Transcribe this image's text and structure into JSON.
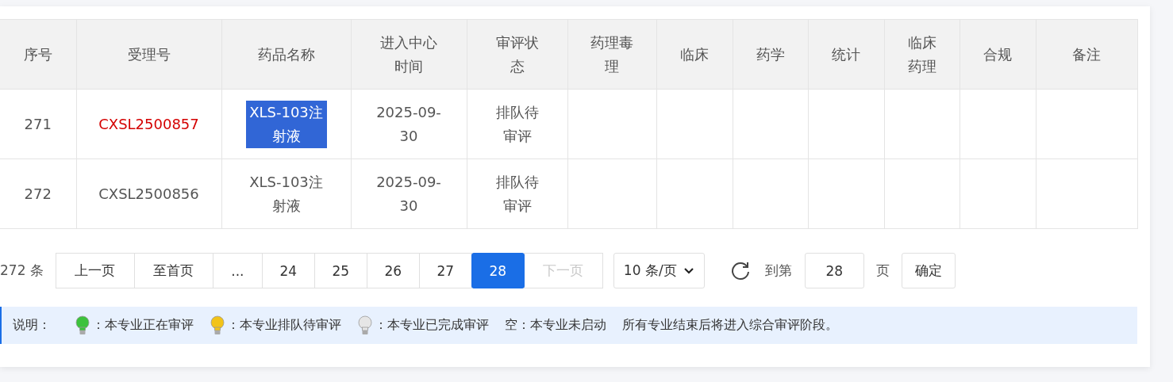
{
  "table": {
    "columns": [
      "序号",
      "受理号",
      "药品名称",
      "进入中心时间",
      "审评状态",
      "药理毒理",
      "临床",
      "药学",
      "统计",
      "临床药理",
      "合规",
      "备注"
    ],
    "rows": [
      {
        "index": "271",
        "accept_no": "CXSL2500857",
        "accept_no_flagged": true,
        "drug_name": "XLS-103注射液",
        "drug_name_selected": true,
        "entry_time": "2025-09-30",
        "status": "排队待审评"
      },
      {
        "index": "272",
        "accept_no": "CXSL2500856",
        "accept_no_flagged": false,
        "drug_name": "XLS-103注射液",
        "drug_name_selected": false,
        "entry_time": "2025-09-30",
        "status": "排队待审评"
      }
    ]
  },
  "pagination": {
    "total": "272 条",
    "buttons": [
      {
        "label": "上一页",
        "selected": false,
        "disabled": false
      },
      {
        "label": "至首页",
        "selected": false,
        "disabled": false
      },
      {
        "label": "...",
        "selected": false,
        "disabled": false
      },
      {
        "label": "24",
        "selected": false,
        "disabled": false
      },
      {
        "label": "25",
        "selected": false,
        "disabled": false
      },
      {
        "label": "26",
        "selected": false,
        "disabled": false
      },
      {
        "label": "27",
        "selected": false,
        "disabled": false
      },
      {
        "label": "28",
        "selected": true,
        "disabled": false
      },
      {
        "label": "下一页",
        "selected": false,
        "disabled": true
      }
    ],
    "page_size": "10 条/页",
    "goto_label": "到第",
    "goto_value": "28",
    "page_unit": "页",
    "confirm": "确定"
  },
  "legend": {
    "label": "说明：",
    "items": [
      {
        "kind": "bulb",
        "color": "#3cc23c",
        "text": "：本专业正在审评"
      },
      {
        "kind": "bulb",
        "color": "#f2c318",
        "text": "：本专业排队待审评"
      },
      {
        "kind": "bulb",
        "color": "#e6e6e6",
        "text": "：本专业已完成审评"
      },
      {
        "kind": "text",
        "text": "空：本专业未启动"
      },
      {
        "kind": "text",
        "text": "所有专业结束后将进入综合审评阶段。"
      }
    ]
  }
}
